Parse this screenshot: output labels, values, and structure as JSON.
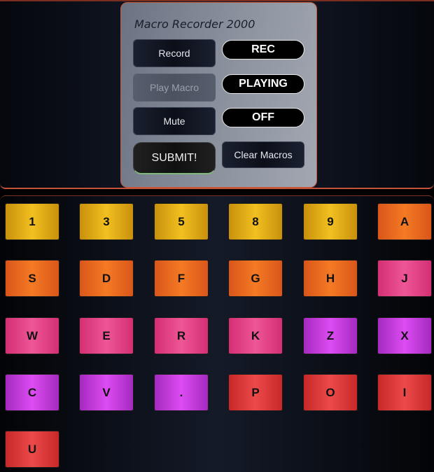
{
  "app": {
    "title": "Macro Recorder 2000"
  },
  "controls": {
    "record_label": "Record",
    "play_label": "Play Macro",
    "mute_label": "Mute",
    "submit_label": "SUBMIT!",
    "clear_label": "Clear Macros",
    "rec_status": "REC",
    "play_status": "PLAYING",
    "mute_status": "OFF"
  },
  "keys": [
    {
      "label": "1",
      "color": "#e0a816"
    },
    {
      "label": "3",
      "color": "#e0a816"
    },
    {
      "label": "5",
      "color": "#e0a816"
    },
    {
      "label": "8",
      "color": "#e0a816"
    },
    {
      "label": "9",
      "color": "#e0a816"
    },
    {
      "label": "A",
      "color": "#ea6a20"
    },
    {
      "label": "S",
      "color": "#ea6a20"
    },
    {
      "label": "D",
      "color": "#ea6a20"
    },
    {
      "label": "F",
      "color": "#ea6a20"
    },
    {
      "label": "G",
      "color": "#ea6a20"
    },
    {
      "label": "H",
      "color": "#ea6a20"
    },
    {
      "label": "J",
      "color": "#e04486"
    },
    {
      "label": "W",
      "color": "#e04486"
    },
    {
      "label": "E",
      "color": "#e04486"
    },
    {
      "label": "R",
      "color": "#e04486"
    },
    {
      "label": "K",
      "color": "#e04486"
    },
    {
      "label": "Z",
      "color": "#c43ed8"
    },
    {
      "label": "X",
      "color": "#c43ed8"
    },
    {
      "label": "C",
      "color": "#c43ed8"
    },
    {
      "label": "V",
      "color": "#c43ed8"
    },
    {
      "label": ".",
      "color": "#c43ed8"
    },
    {
      "label": "P",
      "color": "#dc3838"
    },
    {
      "label": "O",
      "color": "#dc3838"
    },
    {
      "label": "I",
      "color": "#dc3838"
    },
    {
      "label": "U",
      "color": "#dc3838"
    }
  ]
}
